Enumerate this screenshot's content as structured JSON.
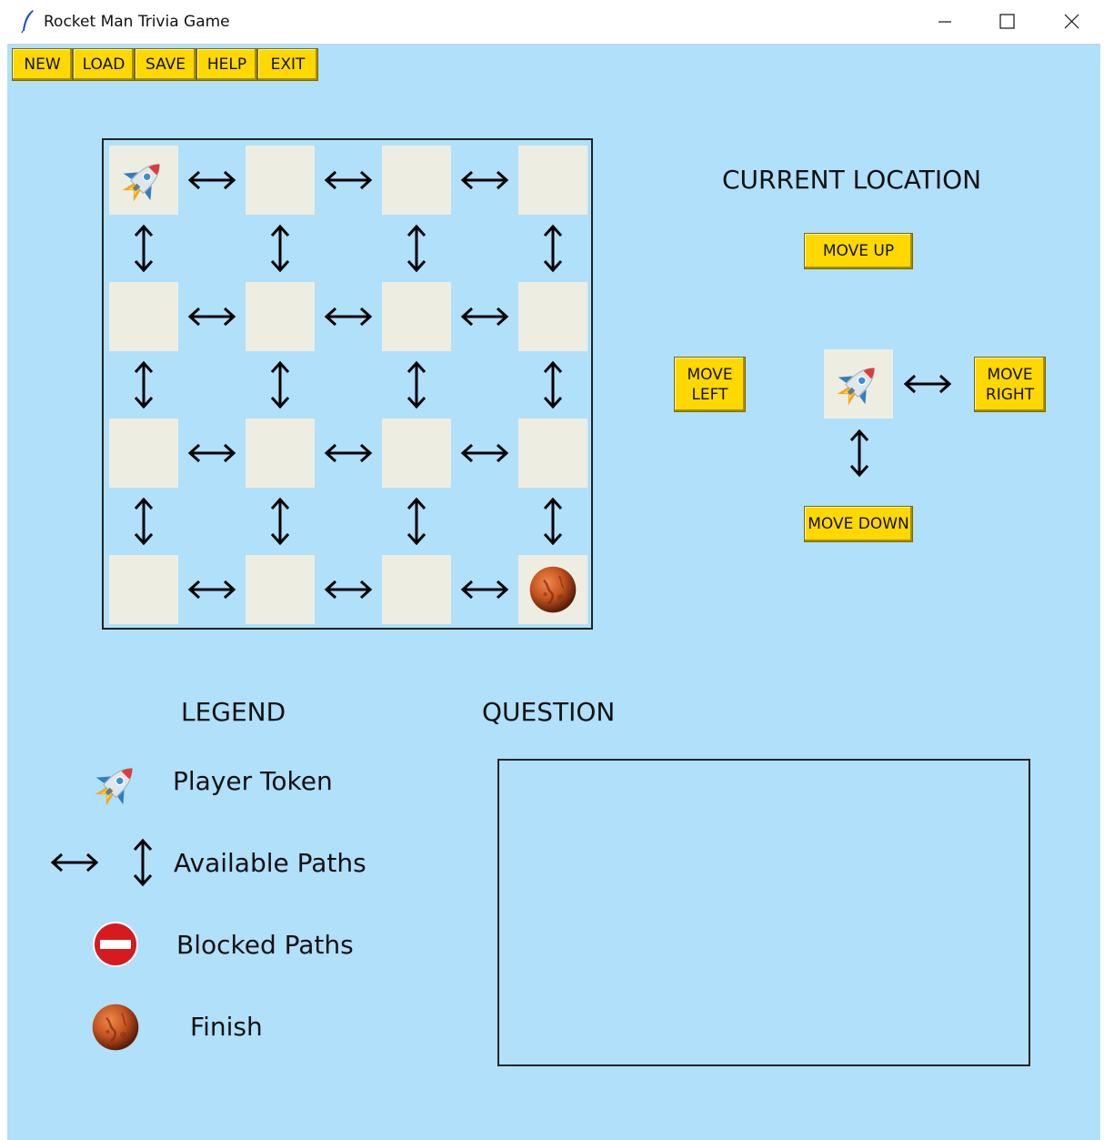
{
  "window": {
    "title": "Rocket Man Trivia Game"
  },
  "menu": {
    "new": "NEW",
    "load": "LOAD",
    "save": "SAVE",
    "help": "HELP",
    "exit": "EXIT"
  },
  "board": {
    "rows": 4,
    "cols": 4,
    "player_cell": [
      0,
      0
    ],
    "finish_cell": [
      3,
      3
    ],
    "paths": "all open"
  },
  "current_location": {
    "heading": "CURRENT LOCATION",
    "move_up": "MOVE UP",
    "move_left_line1": "MOVE",
    "move_left_line2": "LEFT",
    "move_right_line1": "MOVE",
    "move_right_line2": "RIGHT",
    "move_down": "MOVE DOWN"
  },
  "legend": {
    "heading": "LEGEND",
    "player_token": "Player Token",
    "available_paths": "Available Paths",
    "blocked_paths": "Blocked Paths",
    "finish": "Finish"
  },
  "question": {
    "heading": "QUESTION",
    "text": ""
  },
  "colors": {
    "background": "#b0e0fa",
    "button": "#ffd800",
    "cell": "#eeede2",
    "finish": "#c4531f",
    "blocked": "#d71920"
  }
}
